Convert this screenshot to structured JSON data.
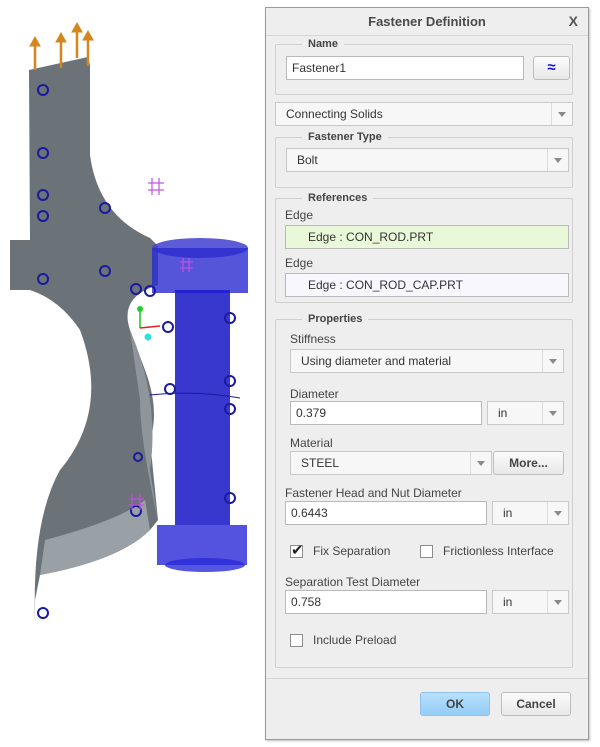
{
  "dialog": {
    "title": "Fastener Definition",
    "close_label": "X",
    "name_group": {
      "legend": "Name",
      "value": "Fastener1",
      "pick_icon": "select-geometry-icon"
    },
    "connection_type": {
      "value": "Connecting Solids"
    },
    "fastener_type_group": {
      "legend": "Fastener Type",
      "value": "Bolt"
    },
    "references_group": {
      "legend": "References",
      "items": [
        {
          "label": "Edge",
          "value": "Edge : CON_ROD.PRT",
          "highlight": "#e8f8d8"
        },
        {
          "label": "Edge",
          "value": "Edge : CON_ROD_CAP.PRT",
          "highlight": "#f8f6ff"
        }
      ]
    },
    "properties_group": {
      "legend": "Properties",
      "stiffness": {
        "label": "Stiffness",
        "value": "Using diameter and material"
      },
      "diameter": {
        "label": "Diameter",
        "value": "0.379",
        "unit": "in"
      },
      "material": {
        "label": "Material",
        "value": "STEEL",
        "more_label": "More..."
      },
      "head_nut_diameter": {
        "label": "Fastener Head and Nut Diameter",
        "value": "0.6443",
        "unit": "in"
      },
      "fix_separation": {
        "label": "Fix Separation",
        "checked": true
      },
      "frictionless_interface": {
        "label": "Frictionless Interface",
        "checked": false
      },
      "separation_test_diameter": {
        "label": "Separation Test Diameter",
        "value": "0.758",
        "unit": "in"
      },
      "include_preload": {
        "label": "Include Preload",
        "checked": false
      }
    },
    "buttons": {
      "ok": "OK",
      "cancel": "Cancel"
    }
  },
  "viewport": {
    "model": "connecting rod with bolt fastener",
    "colors": {
      "part": "#6b7278",
      "part_light": "#9aa1a6",
      "bolt": "#2020c8",
      "load_arrow": "#d4861c",
      "constraint": "#1a1aa0",
      "csys_mark": "#c050e0"
    }
  }
}
